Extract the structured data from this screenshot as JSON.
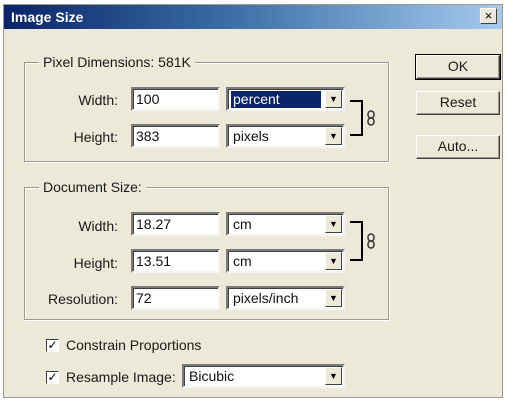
{
  "dialog": {
    "title": "Image Size",
    "close_glyph": "×"
  },
  "pixel_dimensions": {
    "label": "Pixel Dimensions:",
    "size": "581K",
    "width_label": "Width:",
    "width_value": "100",
    "width_unit": "percent",
    "height_label": "Height:",
    "height_value": "383",
    "height_unit": "pixels"
  },
  "document_size": {
    "label": "Document Size:",
    "width_label": "Width:",
    "width_value": "18.27",
    "width_unit": "cm",
    "height_label": "Height:",
    "height_value": "13.51",
    "height_unit": "cm",
    "resolution_label": "Resolution:",
    "resolution_value": "72",
    "resolution_unit": "pixels/inch"
  },
  "options": {
    "constrain_label": "Constrain Proportions",
    "constrain_checked": true,
    "resample_label": "Resample Image:",
    "resample_checked": true,
    "resample_method": "Bicubic"
  },
  "buttons": {
    "ok": "OK",
    "reset": "Reset",
    "auto": "Auto..."
  },
  "icons": {
    "dropdown_arrow": "▼",
    "check": "✓",
    "link": "chain-link-icon"
  }
}
